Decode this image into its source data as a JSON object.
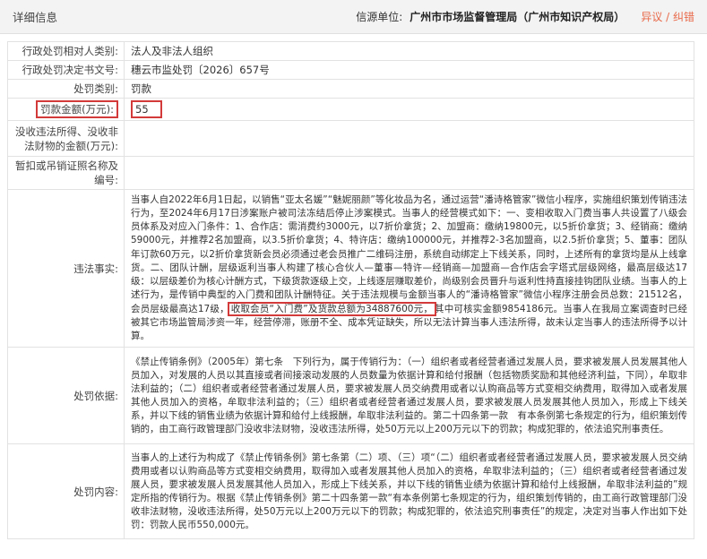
{
  "header": {
    "title": "详细信息",
    "source_label": "信源单位:",
    "source_org": "广州市市场监督管理局（广州市知识产权局）",
    "error_link": "异议 / 纠错"
  },
  "rows": {
    "party_type": {
      "label": "行政处罚相对人类别:",
      "value": "法人及非法人组织"
    },
    "doc_no": {
      "label": "行政处罚决定书文号:",
      "value": "穗云市监处罚〔2026〕657号"
    },
    "penalty_type": {
      "label": "处罚类别:",
      "value": "罚款"
    },
    "fine": {
      "label": "罚款金额(万元):",
      "value": "55"
    },
    "confiscated": {
      "label": "没收违法所得、没收非法财物的金额(万元):",
      "value": ""
    },
    "suspend": {
      "label": "暂扣或吊销证照名称及编号:",
      "value": ""
    },
    "facts": {
      "label": "违法事实:",
      "part1": "当事人自2022年6月1日起，以销售“亚太名媛”“魅妮丽颜”等化妆品为名，通过运营“潘诗格管家”微信小程序，实施组织策划传销违法行为，至2024年6月17日涉案账户被司法冻结后停止涉案模式。当事人的经营模式如下：一、变相收取入门费当事人共设置了八级会员体系及对应入门条件：1、合作店：需消费约3000元，以7折价拿货；2、加盟商：缴纳19800元，以5折价拿货；3、经销商：缴纳59000元，并推荐2名加盟商，以3.5折价拿货；4、特许店：缴纳100000元，并推荐2-3名加盟商，以2.5折价拿货；5、董事：团队年订款60万元，以2折价拿货新会员必须通过老会员推广二维码注册，系统自动绑定上下线关系，同时，上述所有的拿货均是从上线拿货。二、团队计酬，层级返利当事人构建了核心合伙人—董事—特许—经销商—加盟商—合作店会字塔式层级网络，最高层级达17级：以层级差价为核心计酬方式，下级货款逐级上交，上线逐层赚取差价，尚级别会员晋升与返利性持直接挂钩团队业绩。当事人的上述行为，是传销中典型的入门费和团队计酬特征。关于违法规模与金额当事人的“潘诗格管家”微信小程序注册会员总数：21512名，会员层级最高达17级，",
      "highlight": "收取会员“入门费”及货款总额为34887600元，",
      "part2": "其中可核实金额9854186元。当事人在我局立案调查时已经被其它市场监管局涉资一年，经营停滞，账册不全、成本凭证缺失，所以无法计算当事人违法所得，故未认定当事人的违法所得予以计算。"
    },
    "basis": {
      "label": "处罚依据:",
      "value": "《禁止传销条例》（2005年）第七条　下列行为，属于传销行为：（一）组织者或者经营者通过发展人员，要求被发展人员发展其他人员加入，对发展的人员以其直接或者间接滚动发展的人员数量为依据计算和给付报酬（包括物质奖励和其他经济利益，下同），牟取非法利益的；（二）组织者或者经营者通过发展人员，要求被发展人员交纳费用或者以认购商品等方式变相交纳费用，取得加入或者发展其他人员加入的资格，牟取非法利益的；（三）组织者或者经营者通过发展人员，要求被发展人员发展其他人员加入，形成上下线关系，并以下线的销售业绩为依据计算和给付上线报酬，牟取非法利益的。第二十四条第一款　有本条例第七条规定的行为，组织策划传销的，由工商行政管理部门没收非法财物，没收违法所得，处50万元以上200万元以下的罚款；构成犯罪的，依法追究刑事责任。"
    },
    "content": {
      "label": "处罚内容:",
      "value": "当事人的上述行为构成了《禁止传销条例》第七条第（二）项、（三）项“（二）组织者或者经营者通过发展人员，要求被发展人员交纳费用或者以认购商品等方式变相交纳费用，取得加入或者发展其他人员加入的资格，牟取非法利益的；（三）组织者或者经营者通过发展人员，要求被发展人员发展其他人员加入，形成上下线关系，并以下线的销售业绩为依据计算和给付上线报酬，牟取非法利益的”规定所指的传销行为。根据《禁止传销条例》第二十四条第一款“有本条例第七条规定的行为，组织策划传销的，由工商行政管理部门没收非法财物，没收违法所得，处50万元以上200万元以下的罚款；构成犯罪的，依法追究刑事责任”的规定，决定对当事人作出如下处罚：罚款人民币550,000元。"
    }
  }
}
